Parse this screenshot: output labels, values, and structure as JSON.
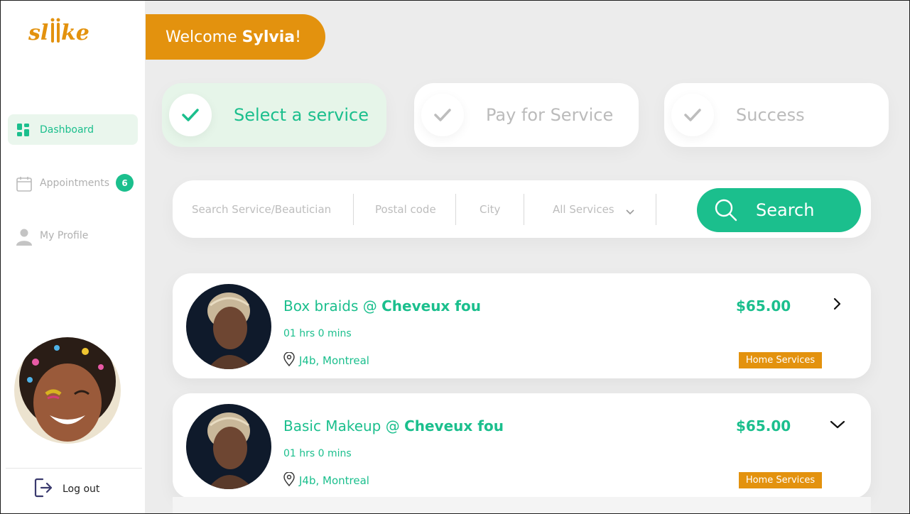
{
  "app": {
    "logo_text": "sliike"
  },
  "colors": {
    "accent": "#1bbf8d",
    "brand": "#e3920e",
    "active_bg": "#eaf6ed"
  },
  "sidebar": {
    "items": [
      {
        "label": "Dashboard",
        "icon": "dashboard-icon",
        "active": true
      },
      {
        "label": "Appointments",
        "icon": "calendar-icon",
        "badge": "6"
      },
      {
        "label": "My Profile",
        "icon": "user-icon"
      }
    ],
    "logout_label": "Log out"
  },
  "welcome": {
    "prefix": "Welcome ",
    "name": "Sylvia",
    "suffix": "!"
  },
  "steps": [
    {
      "label": "Select a service",
      "active": true
    },
    {
      "label": "Pay for Service",
      "active": false
    },
    {
      "label": "Success",
      "active": false
    }
  ],
  "search": {
    "service_placeholder": "Search Service/Beautician",
    "postal_placeholder": "Postal code",
    "city_placeholder": "City",
    "services_select": "All Services",
    "button_label": "Search"
  },
  "results": [
    {
      "service": "Box braids @ ",
      "business": "Cheveux fou",
      "duration": "01 hrs 0 mins",
      "location": "J4b, Montreal",
      "price": "$65.00",
      "tag": "Home Services",
      "chevron": "chevron-right-icon"
    },
    {
      "service": "Basic Makeup @ ",
      "business": "Cheveux fou",
      "duration": "01 hrs 0 mins",
      "location": "J4b, Montreal",
      "price": "$65.00",
      "tag": "Home Services",
      "chevron": "chevron-down-icon"
    }
  ]
}
